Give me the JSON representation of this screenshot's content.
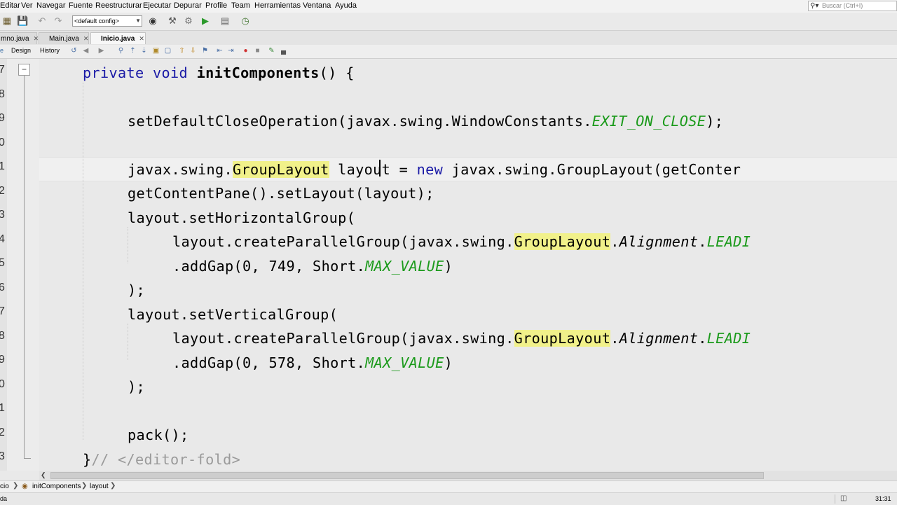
{
  "menu": {
    "items": [
      "Editar",
      "Ver",
      "Navegar",
      "Fuente",
      "Reestructurar",
      "Ejecutar",
      "Depurar",
      "Profile",
      "Team",
      "Herramientas",
      "Ventana",
      "Ayuda"
    ]
  },
  "search": {
    "placeholder": "Buscar (Ctrl+I)"
  },
  "toolbar": {
    "config": "<default config>"
  },
  "tabs": [
    {
      "label": "mno.java",
      "active": false
    },
    {
      "label": "Main.java",
      "active": false
    },
    {
      "label": "Inicio.java",
      "active": true
    }
  ],
  "editor_toolbar": {
    "design_label": "Design",
    "history_label": "History"
  },
  "line_numbers": [
    "7",
    "8",
    "9",
    "0",
    "1",
    "2",
    "3",
    "4",
    "5",
    "6",
    "7",
    "8",
    "9",
    "0",
    "1",
    "2",
    "3"
  ],
  "code": {
    "l1_kw": "private void ",
    "l1_name": "initComponents",
    "l1_rest": "() {",
    "l3_a": "setDefaultCloseOperation(javax.swing.WindowConstants.",
    "l3_const": "EXIT_ON_CLOSE",
    "l3_b": ");",
    "l5_a": "javax.swing.",
    "l5_hl": "GroupLayout",
    "l5_b": " layout = ",
    "l5_kw": "new",
    "l5_c": " javax.swing.GroupLayout(getConter",
    "l6": "getContentPane().setLayout(layout);",
    "l7": "layout.setHorizontalGroup(",
    "l8_a": "layout.createParallelGroup(javax.swing.",
    "l8_hl": "GroupLayout",
    "l8_b": ".",
    "l8_ital": "Alignment",
    "l8_c": ".",
    "l8_const": "LEADI",
    "l9_a": ".addGap(0, 749, Short.",
    "l9_const": "MAX_VALUE",
    "l9_b": ")",
    "l10": ");",
    "l11": "layout.setVerticalGroup(",
    "l12_a": "layout.createParallelGroup(javax.swing.",
    "l12_hl": "GroupLayout",
    "l12_b": ".",
    "l12_ital": "Alignment",
    "l12_c": ".",
    "l12_const": "LEADI",
    "l13_a": ".addGap(0, 578, Short.",
    "l13_const": "MAX_VALUE",
    "l13_b": ")",
    "l14": ");",
    "l16": "pack();",
    "l17_a": "}",
    "l17_cmt": "// </editor-fold>"
  },
  "breadcrumb": {
    "items": [
      "cio",
      "initComponents",
      "layout"
    ]
  },
  "status": {
    "left": "da",
    "position": "31:31"
  },
  "colors": {
    "keyword": "#1a1aa6",
    "constant": "#1b9a1b",
    "highlight": "#f1f18a",
    "comment": "#9a9a9a"
  }
}
